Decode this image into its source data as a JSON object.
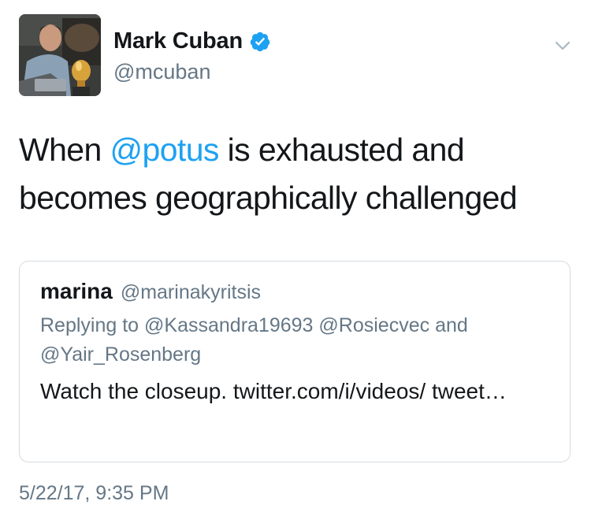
{
  "author": {
    "display_name": "Mark Cuban",
    "handle": "@mcuban",
    "verified": true,
    "avatar_icon": "profile-photo"
  },
  "menu": {
    "icon": "chevron-down-icon"
  },
  "tweet": {
    "text_before": "When ",
    "mention": "@potus",
    "text_after": " is exhausted and becomes geographically challenged",
    "timestamp": "5/22/17, 9:35 PM"
  },
  "quoted_tweet": {
    "name": "marina",
    "handle": "@marinakyritsis",
    "replying_prefix": "Replying to",
    "replying_to": [
      "@Kassandra19693",
      "@Rosiecvec",
      "@Yair_Rosenberg"
    ],
    "replying_joiner": "and",
    "body": "Watch the closeup. twitter.com/i/videos/ tweet…"
  },
  "colors": {
    "link": "#1da1f2",
    "secondary_text": "#657786",
    "primary_text": "#14171a",
    "border": "#d6dbe0",
    "verified_badge": "#1da1f2"
  }
}
